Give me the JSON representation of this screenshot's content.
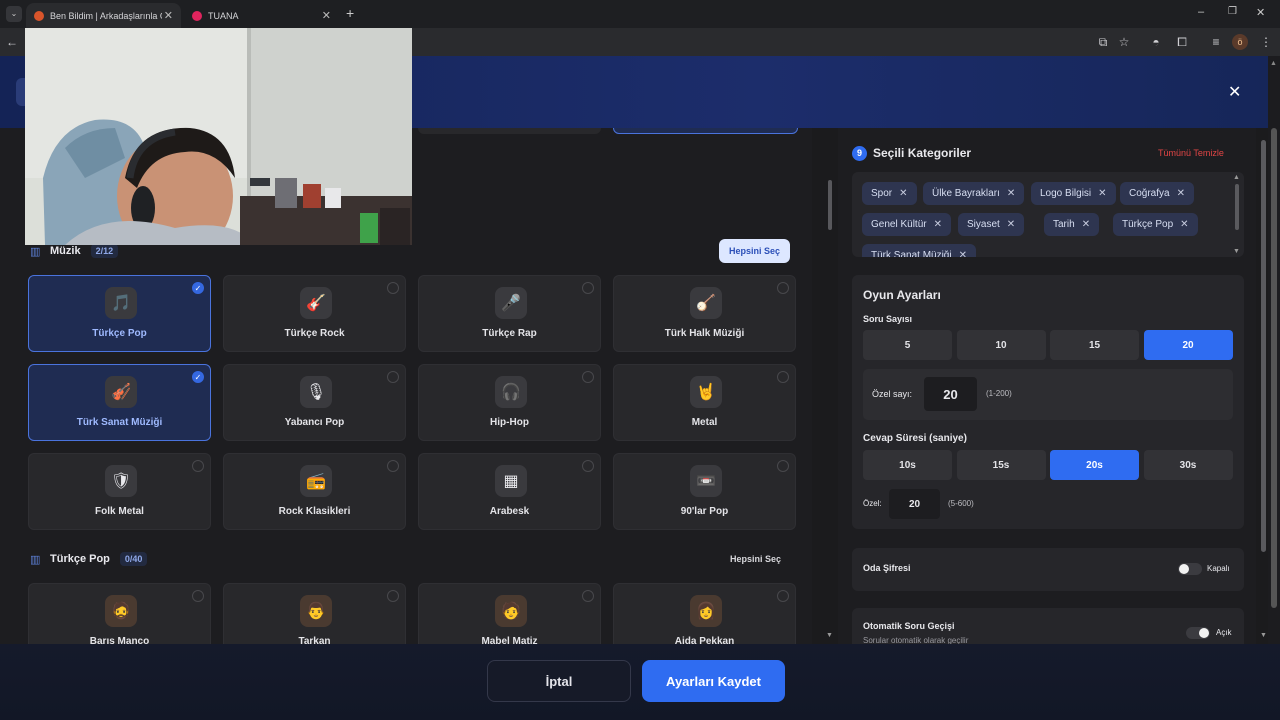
{
  "browser": {
    "tabs": [
      {
        "title": "Ben Bildim | Arkadaşlarınla Onl…"
      },
      {
        "title": "TUANA"
      }
    ],
    "new_tab": "+",
    "window": {
      "minimize": "–",
      "restore": "❐",
      "close": "✕"
    },
    "profile_initial": "ö"
  },
  "modal": {
    "close": "✕"
  },
  "music_section": {
    "title": "Müzik",
    "count": "2/12",
    "select_all": "Hepsini Seç",
    "cards": [
      {
        "label": "Türkçe Pop",
        "icon": "🎵",
        "selected": true
      },
      {
        "label": "Türkçe Rock",
        "icon": "🎸",
        "selected": false
      },
      {
        "label": "Türkçe Rap",
        "icon": "🎤",
        "selected": false
      },
      {
        "label": "Türk Halk Müziği",
        "icon": "🪕",
        "selected": false
      },
      {
        "label": "Türk Sanat Müziği",
        "icon": "🎻",
        "selected": true
      },
      {
        "label": "Yabancı Pop",
        "icon": "🎙",
        "selected": false
      },
      {
        "label": "Hip-Hop",
        "icon": "🎧",
        "selected": false
      },
      {
        "label": "Metal",
        "icon": "🤘",
        "selected": false
      },
      {
        "label": "Folk Metal",
        "icon": "🛡",
        "selected": false
      },
      {
        "label": "Rock Klasikleri",
        "icon": "📻",
        "selected": false
      },
      {
        "label": "Arabesk",
        "icon": "▦",
        "selected": false
      },
      {
        "label": "90'lar Pop",
        "icon": "📼",
        "selected": false
      }
    ]
  },
  "pop_section": {
    "title": "Türkçe Pop",
    "count": "0/40",
    "select_all": "Hepsini Seç",
    "cards": [
      {
        "label": "Barış Manço",
        "icon": "🧔"
      },
      {
        "label": "Tarkan",
        "icon": "👨"
      },
      {
        "label": "Mabel Matiz",
        "icon": "🧑"
      },
      {
        "label": "Ajda Pekkan",
        "icon": "👩"
      }
    ]
  },
  "selected_categories": {
    "count": "9",
    "title": "Seçili Kategoriler",
    "clear_all": "Tümünü Temizle",
    "chips": [
      "Spor",
      "Ülke Bayrakları",
      "Logo Bilgisi",
      "Coğrafya",
      "Genel Kültür",
      "Siyaset",
      "Tarih",
      "Türkçe Pop",
      "Türk Sanat Müziği"
    ],
    "chip_remove": "✕"
  },
  "game_settings": {
    "title": "Oyun Ayarları",
    "question_count_label": "Soru Sayısı",
    "question_counts": [
      "5",
      "10",
      "15",
      "20"
    ],
    "question_count_selected": "20",
    "custom_count_label": "Özel sayı:",
    "custom_count_value": "20",
    "custom_count_range": "(1-200)",
    "answer_time_label": "Cevap Süresi (saniye)",
    "answer_times": [
      "10s",
      "15s",
      "20s",
      "30s"
    ],
    "answer_time_selected": "20s",
    "custom_time_label": "Özel:",
    "custom_time_value": "20",
    "custom_time_range": "(5-600)"
  },
  "room_password": {
    "label": "Oda Şifresi",
    "state": "Kapalı",
    "on": false
  },
  "auto_next": {
    "label": "Otomatik Soru Geçişi",
    "desc": "Sorular otomatik olarak geçilir",
    "state": "Açık",
    "on": true
  },
  "footer": {
    "cancel": "İptal",
    "save": "Ayarları Kaydet"
  },
  "colors": {
    "accent": "#2f6cf1",
    "danger": "#e04545",
    "header_bg": "#1c2d6b"
  }
}
